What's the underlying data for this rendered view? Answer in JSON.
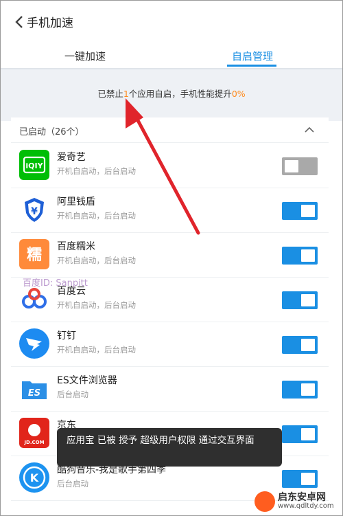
{
  "header": {
    "title": "手机加速"
  },
  "tabs": [
    {
      "label": "一键加速",
      "active": false
    },
    {
      "label": "自启管理",
      "active": true
    }
  ],
  "summary": {
    "prefix": "已禁止",
    "count": "1",
    "middle": "个应用自启，手机性能提升",
    "percent": "0%"
  },
  "section": {
    "title": "已启动（26个）"
  },
  "apps": [
    {
      "name": "爱奇艺",
      "sub": "开机自启动，后台启动",
      "enabled": false,
      "icon": "iqiyi-icon"
    },
    {
      "name": "阿里钱盾",
      "sub": "开机自启动，后台启动",
      "enabled": true,
      "icon": "qiandun-icon"
    },
    {
      "name": "百度糯米",
      "sub": "开机自启动，后台启动",
      "enabled": true,
      "icon": "nuomi-icon"
    },
    {
      "name": "百度云",
      "sub": "开机自启动，后台启动",
      "enabled": true,
      "icon": "baiduyun-icon"
    },
    {
      "name": "钉钉",
      "sub": "开机自启动，后台启动",
      "enabled": true,
      "icon": "dingtalk-icon"
    },
    {
      "name": "ES文件浏览器",
      "sub": "后台启动",
      "enabled": true,
      "icon": "es-explorer-icon"
    },
    {
      "name": "京东",
      "sub": "",
      "enabled": true,
      "icon": "jd-icon"
    },
    {
      "name": "酷狗音乐-我是歌手第四季",
      "sub": "后台启动",
      "enabled": true,
      "icon": "kugou-icon"
    }
  ],
  "toast": {
    "text": "应用宝 已被 授予 超级用户权限 通过交互界面"
  },
  "watermarks": {
    "baidu": "百度ID: Sanpitt",
    "site_name": "启东安卓网",
    "site_url": "www.qdltdy.com"
  },
  "colors": {
    "accent": "#1a8fe3",
    "highlight": "#ff8a1c",
    "arrow": "#e0242b"
  }
}
